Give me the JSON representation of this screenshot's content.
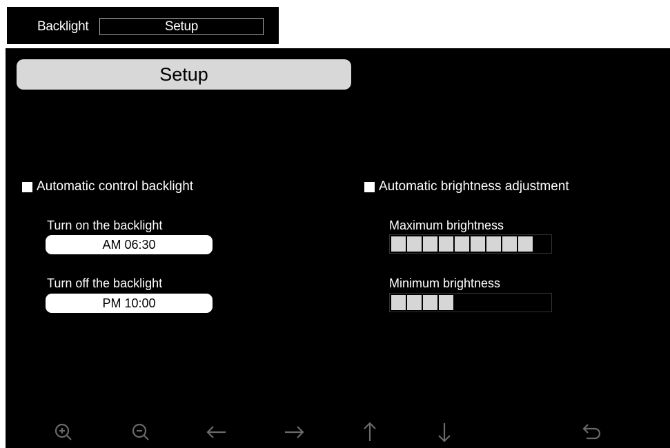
{
  "top_strip": {
    "label": "Backlight",
    "value": "Setup"
  },
  "screen": {
    "title": "Setup",
    "backlight": {
      "auto_label": "Automatic control backlight",
      "turn_on_label": "Turn on the backlight",
      "turn_on_value": "AM 06:30",
      "turn_off_label": "Turn off the backlight",
      "turn_off_value": "PM 10:00"
    },
    "brightness": {
      "auto_label": "Automatic brightness adjustment",
      "max_label": "Maximum brightness",
      "max_level": 9,
      "min_label": "Minimum brightness",
      "min_level": 4,
      "level_scale": 10
    }
  },
  "toolbar": {
    "icons": [
      "zoom-in-icon",
      "zoom-out-icon",
      "arrow-left-icon",
      "arrow-right-icon",
      "arrow-up-icon",
      "arrow-down-icon",
      "return-icon"
    ]
  }
}
